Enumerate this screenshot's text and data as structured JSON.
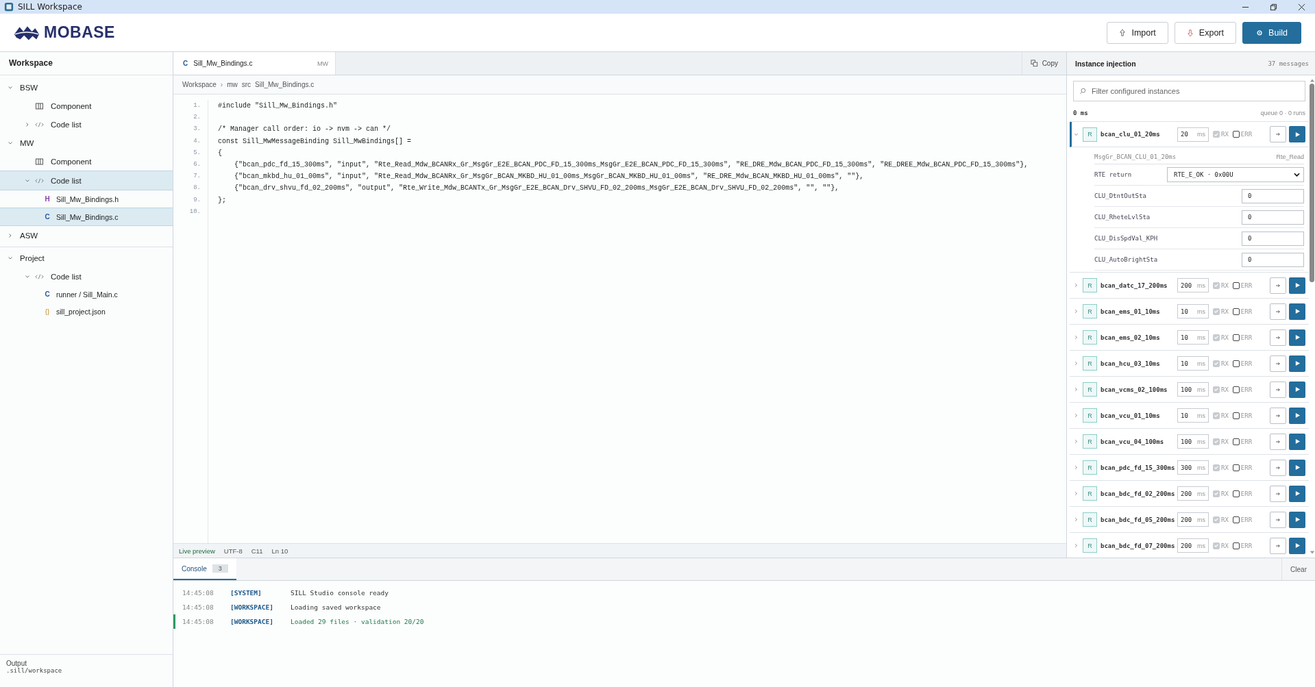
{
  "window": {
    "title": "SILL Workspace"
  },
  "header": {
    "logo": "MOBASE",
    "buttons": [
      {
        "label": "Import",
        "kind": "import"
      },
      {
        "label": "Export",
        "kind": "export"
      },
      {
        "label": "Build",
        "kind": "build"
      }
    ]
  },
  "sidebar": {
    "title": "Workspace",
    "sections": [
      {
        "label": "BSW",
        "expanded": true,
        "items": [
          {
            "label": "Component",
            "kind": "component",
            "selected": false
          },
          {
            "label": "Code list",
            "kind": "code",
            "expanded": false,
            "selected": false
          }
        ]
      },
      {
        "label": "MW",
        "expanded": true,
        "items": [
          {
            "label": "Component",
            "kind": "component",
            "selected": false
          },
          {
            "label": "Code list",
            "kind": "code",
            "expanded": true,
            "selected": true,
            "children": [
              {
                "badge": "H",
                "label": "Sill_Mw_Bindings.h",
                "selected": false
              },
              {
                "badge": "C",
                "label": "Sill_Mw_Bindings.c",
                "selected": true
              }
            ]
          }
        ]
      },
      {
        "label": "ASW",
        "expanded": false
      },
      {
        "label": "Project",
        "expanded": true,
        "items": [
          {
            "label": "Code list",
            "kind": "code",
            "expanded": true,
            "selected": false,
            "children": [
              {
                "badge": "C",
                "label": "runner / Sill_Main.c",
                "selected": false
              },
              {
                "badge": "{}",
                "label": "sill_project.json",
                "selected": false
              }
            ]
          }
        ]
      }
    ],
    "footer": {
      "label": "Output",
      "path": ".sill/workspace"
    }
  },
  "editor": {
    "tab": {
      "badge": "C",
      "label": "Sill_Mw_Bindings.c",
      "tag": "MW",
      "selected": true
    },
    "copy": "Copy",
    "breadcrumb": [
      "Workspace",
      "mw",
      "src",
      "Sill_Mw_Bindings.c"
    ],
    "breadcrumb_separator": "›",
    "lines": [
      {
        "number": "1.",
        "text": "#include \"Sill_Mw_Bindings.h\""
      },
      {
        "number": "2."
      },
      {
        "number": "3.",
        "text": "/* Manager call order: io -> nvm -> can */"
      },
      {
        "number": "4.",
        "text": "const Sill_MwMessageBinding Sill_MwBindings[] ="
      },
      {
        "number": "5.",
        "text": "{"
      },
      {
        "number": "6.",
        "text": "    {\"bcan_pdc_fd_15_300ms\", \"input\", \"Rte_Read_Mdw_BCANRx_Gr_MsgGr_E2E_BCAN_PDC_FD_15_300ms_MsgGr_E2E_BCAN_PDC_FD_15_300ms\", \"RE_DRE_Mdw_BCAN_PDC_FD_15_300ms\", \"RE_DREE_Mdw_BCAN_PDC_FD_15_300ms\"},"
      },
      {
        "number": "7.",
        "text": "    {\"bcan_mkbd_hu_01_00ms\", \"input\", \"Rte_Read_Mdw_BCANRx_Gr_MsgGr_BCAN_MKBD_HU_01_00ms_MsgGr_BCAN_MKBD_HU_01_00ms\", \"RE_DRE_Mdw_BCAN_MKBD_HU_01_00ms\", \"\"},"
      },
      {
        "number": "8.",
        "text": "    {\"bcan_drv_shvu_fd_02_200ms\", \"output\", \"Rte_Write_Mdw_BCANTx_Gr_MsgGr_E2E_BCAN_Drv_SHVU_FD_02_200ms_MsgGr_E2E_BCAN_Drv_SHVU_FD_02_200ms\", \"\", \"\"},"
      },
      {
        "number": "9.",
        "text": "};"
      },
      {
        "number": "10."
      }
    ],
    "status": [
      "Live preview",
      "UTF-8",
      "C11",
      "Ln 10"
    ]
  },
  "console": {
    "tab": {
      "label": "Console",
      "count": "3",
      "selected": true
    },
    "clear": "Clear",
    "lines": [
      {
        "time": "14:45:08",
        "tag": "[SYSTEM]",
        "message": "SILL Studio console ready",
        "highlight": false
      },
      {
        "time": "14:45:08",
        "tag": "[WORKSPACE]",
        "message": "Loading saved workspace",
        "highlight": false
      },
      {
        "time": "14:45:08",
        "tag": "[WORKSPACE]",
        "message": "Loaded 29 files · validation 20/20",
        "highlight": true
      }
    ]
  },
  "injection": {
    "title": "Instance injection",
    "count": "37 messages",
    "filter": {
      "placeholder": "Filter configured instances"
    },
    "clock": "0 ms",
    "queue": "queue 0 · 0 runs",
    "rows": [
      {
        "badge": "R",
        "name": "bcan_clu_01_20ms",
        "period": "20",
        "unit": "ms",
        "rx": true,
        "rx_label": "RX",
        "err": false,
        "err_label": "ERR",
        "expanded": true,
        "detail": {
          "message": "MsgGr_BCAN_CLU_01_20ms",
          "api": "Rte_Read",
          "return_label": "RTE return",
          "return_value": "RTE_E_OK · 0x00U",
          "signals": [
            {
              "name": "CLU_DtntOutSta",
              "value": "0"
            },
            {
              "name": "CLU_RheteLvlSta",
              "value": "0"
            },
            {
              "name": "CLU_DisSpdVal_KPH",
              "value": "0"
            },
            {
              "name": "CLU_AutoBrightSta",
              "value": "0"
            }
          ]
        }
      },
      {
        "badge": "R",
        "name": "bcan_datc_17_200ms",
        "period": "200",
        "unit": "ms",
        "rx": true,
        "rx_label": "RX",
        "err": false,
        "err_label": "ERR",
        "expanded": false
      },
      {
        "badge": "R",
        "name": "bcan_ems_01_10ms",
        "period": "10",
        "unit": "ms",
        "rx": true,
        "rx_label": "RX",
        "err": false,
        "err_label": "ERR",
        "expanded": false
      },
      {
        "badge": "R",
        "name": "bcan_ems_02_10ms",
        "period": "10",
        "unit": "ms",
        "rx": true,
        "rx_label": "RX",
        "err": false,
        "err_label": "ERR",
        "expanded": false
      },
      {
        "badge": "R",
        "name": "bcan_hcu_03_10ms",
        "period": "10",
        "unit": "ms",
        "rx": true,
        "rx_label": "RX",
        "err": false,
        "err_label": "ERR",
        "expanded": false
      },
      {
        "badge": "R",
        "name": "bcan_vcms_02_100ms",
        "period": "100",
        "unit": "ms",
        "rx": true,
        "rx_label": "RX",
        "err": false,
        "err_label": "ERR",
        "expanded": false
      },
      {
        "badge": "R",
        "name": "bcan_vcu_01_10ms",
        "period": "10",
        "unit": "ms",
        "rx": true,
        "rx_label": "RX",
        "err": false,
        "err_label": "ERR",
        "expanded": false
      },
      {
        "badge": "R",
        "name": "bcan_vcu_04_100ms",
        "period": "100",
        "unit": "ms",
        "rx": true,
        "rx_label": "RX",
        "err": false,
        "err_label": "ERR",
        "expanded": false
      },
      {
        "badge": "R",
        "name": "bcan_pdc_fd_15_300ms",
        "period": "300",
        "unit": "ms",
        "rx": true,
        "rx_label": "RX",
        "err": false,
        "err_label": "ERR",
        "expanded": false
      },
      {
        "badge": "R",
        "name": "bcan_bdc_fd_02_200ms",
        "period": "200",
        "unit": "ms",
        "rx": true,
        "rx_label": "RX",
        "err": false,
        "err_label": "ERR",
        "expanded": false
      },
      {
        "badge": "R",
        "name": "bcan_bdc_fd_05_200ms",
        "period": "200",
        "unit": "ms",
        "rx": true,
        "rx_label": "RX",
        "err": false,
        "err_label": "ERR",
        "expanded": false
      },
      {
        "badge": "R",
        "name": "bcan_bdc_fd_07_200ms",
        "period": "200",
        "unit": "ms",
        "rx": true,
        "rx_label": "RX",
        "err": false,
        "err_label": "ERR",
        "expanded": false
      }
    ]
  }
}
